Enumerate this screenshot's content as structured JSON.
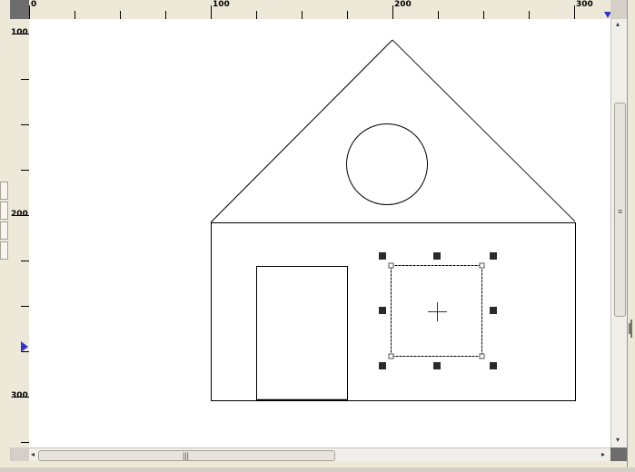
{
  "rulers": {
    "top_labels": [
      "0",
      "100",
      "200",
      "300"
    ],
    "left_labels": [
      "100",
      "200",
      "300"
    ]
  },
  "scrollbars": {
    "vertical_grip": "≡",
    "horizontal_grip": "|||",
    "arrow_left": "◂",
    "arrow_right": "▸",
    "arrow_up": "▴",
    "arrow_down": "▾"
  },
  "colors": {
    "canvas": "#ffffff",
    "stroke": "#000000",
    "marker": "#3333cc",
    "handle": "#2a2a2a"
  },
  "icons": {
    "resize_cursor": "resize-cursor-icon",
    "move_cursor": "crosshair-icon"
  }
}
